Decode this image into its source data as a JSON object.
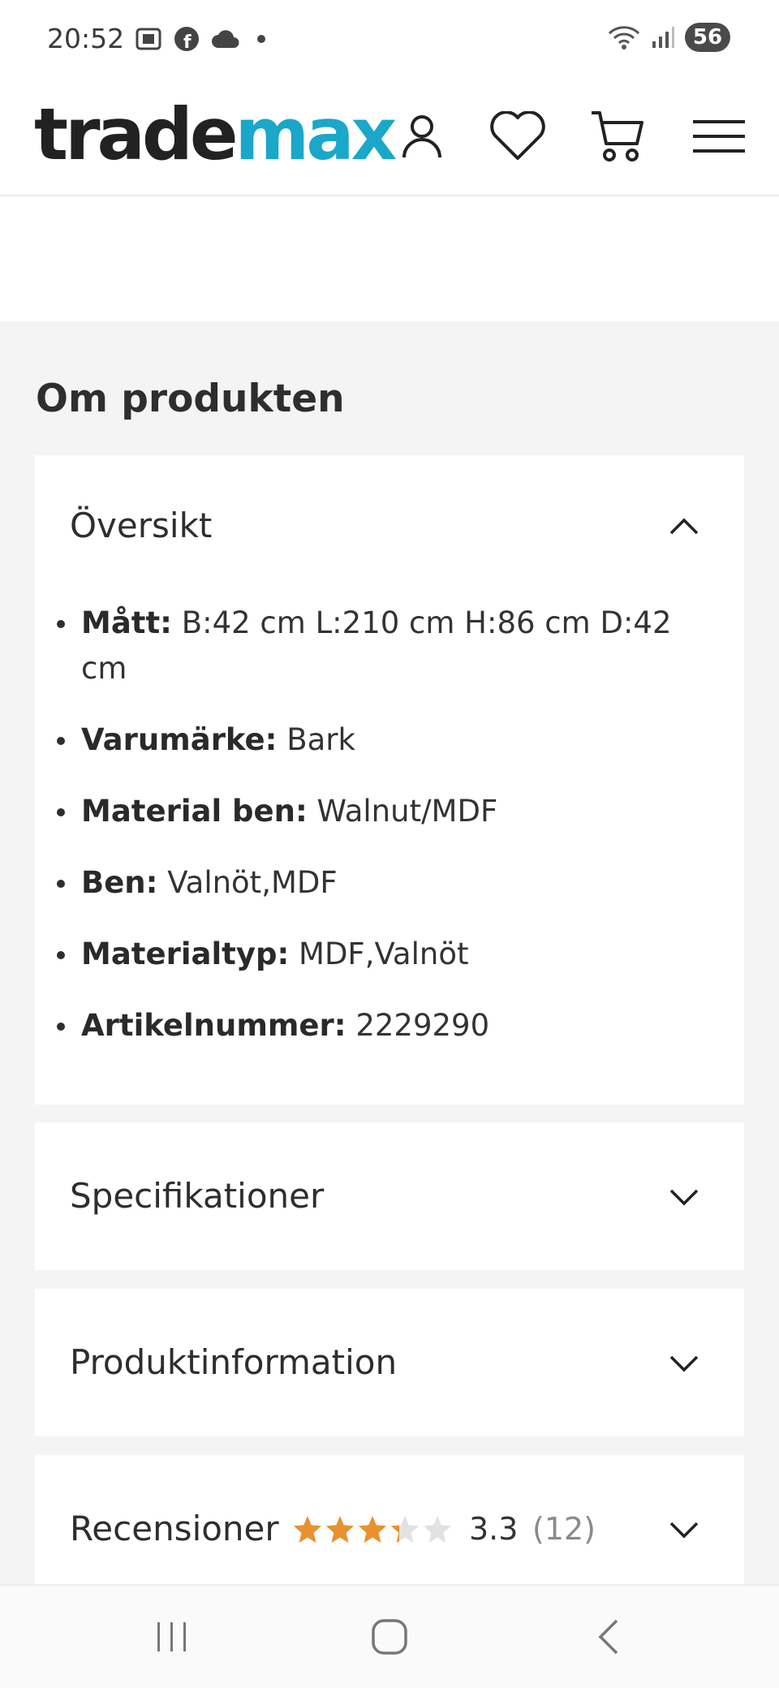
{
  "status": {
    "time": "20:52",
    "battery": "56"
  },
  "header": {
    "logo_part1": "trade",
    "logo_part2": "max",
    "icons": [
      "account-icon",
      "heart-icon",
      "cart-icon",
      "menu-icon"
    ]
  },
  "section": {
    "title": "Om produkten"
  },
  "overview": {
    "title": "Översikt",
    "items": [
      {
        "label": "Mått:",
        "value": "B:42 cm L:210 cm H:86 cm D:42 cm"
      },
      {
        "label": "Varumärke:",
        "value": "Bark"
      },
      {
        "label": "Material ben:",
        "value": "Walnut/MDF"
      },
      {
        "label": "Ben:",
        "value": "Valnöt,MDF"
      },
      {
        "label": "Materialtyp:",
        "value": "MDF,Valnöt"
      },
      {
        "label": "Artikelnummer:",
        "value": "2229290"
      }
    ]
  },
  "accordions": [
    {
      "title": "Specifikationer"
    },
    {
      "title": "Produktinformation"
    },
    {
      "title": "Recensioner"
    }
  ],
  "reviews": {
    "rating": "3.3",
    "count": "(12)",
    "stars_value": 3.3,
    "stars_max": 5
  },
  "colors": {
    "accent": "#1aa7c9",
    "star": "#e8912e",
    "star_empty": "#e2e2e2"
  }
}
